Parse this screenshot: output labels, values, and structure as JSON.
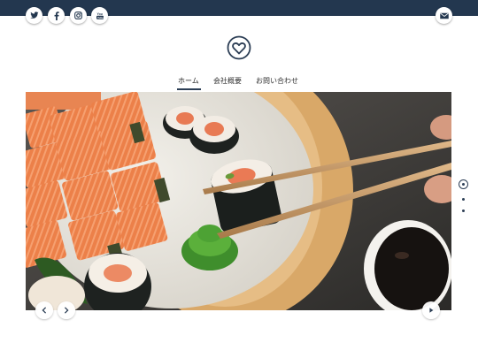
{
  "header": {
    "social_icons": [
      "twitter-icon",
      "facebook-icon",
      "instagram-icon",
      "youtube-icon"
    ],
    "mail_icon": "mail-icon",
    "brand_color": "#23374f"
  },
  "logo": {
    "icon": "heart-icon"
  },
  "nav": {
    "items": [
      {
        "label": "ホーム",
        "active": true
      },
      {
        "label": "会社概要",
        "active": false
      },
      {
        "label": "お問い合わせ",
        "active": false
      }
    ]
  },
  "hero": {
    "image": "sushi-with-chopsticks-photo",
    "prev_icon": "chevron-left-icon",
    "next_icon": "chevron-right-icon",
    "play_icon": "play-icon"
  },
  "slider": {
    "dots": 3,
    "active_index": 0
  }
}
